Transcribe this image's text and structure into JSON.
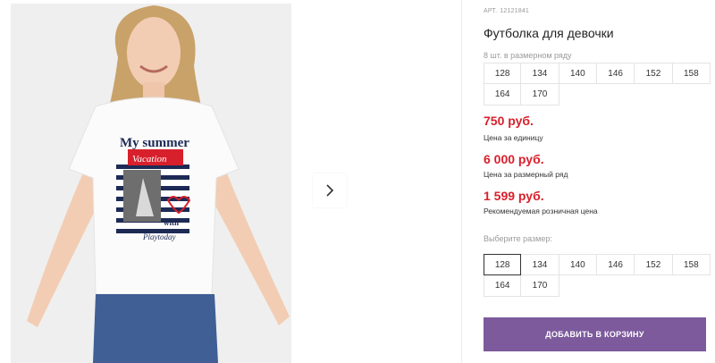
{
  "product": {
    "article_prefix": "АРТ.",
    "article_number": "12121841",
    "title": "Футболка для девочки",
    "image_print": {
      "line1": "My summer",
      "line2": "Vacation",
      "line3": "with",
      "line4": "Playtoday"
    }
  },
  "pack": {
    "label": "8 шт. в размерном ряду",
    "sizes": [
      "128",
      "134",
      "140",
      "146",
      "152",
      "158",
      "164",
      "170"
    ]
  },
  "prices": [
    {
      "value": "750 руб.",
      "label": "Цена за единицу"
    },
    {
      "value": "6 000 руб.",
      "label": "Цена за размерный ряд"
    },
    {
      "value": "1 599 руб.",
      "label": "Рекомендуемая розничная цена"
    }
  ],
  "size_select": {
    "label": "Выберите размер:",
    "sizes": [
      "128",
      "134",
      "140",
      "146",
      "152",
      "158",
      "164",
      "170"
    ],
    "selected": "128"
  },
  "cart": {
    "button_label": "ДОБАВИТЬ В КОРЗИНУ"
  },
  "colors": {
    "price_red": "#d8202c",
    "button_purple": "#7c5a9c",
    "selected_border": "#333333"
  },
  "icons": {
    "next": "chevron-right-icon"
  }
}
